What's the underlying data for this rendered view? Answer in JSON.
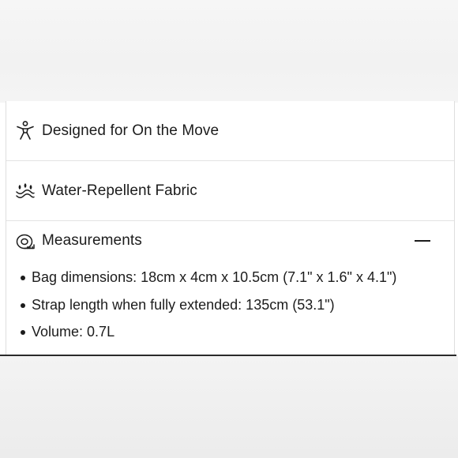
{
  "accordion": {
    "items": [
      {
        "label": "Designed for On the Move",
        "icon": "person-move-icon"
      },
      {
        "label": "Water-Repellent Fabric",
        "icon": "water-drop-icon"
      },
      {
        "label": "Measurements",
        "icon": "tape-measure-icon",
        "expanded": true,
        "toggle_icon": "minus-icon"
      }
    ],
    "measurements": [
      "Bag dimensions: 18cm x 4cm x 10.5cm (7.1\" x 1.6\" x 4.1\")",
      "Strap length when fully extended: 135cm (53.1\")",
      "Volume: 0.7L"
    ]
  }
}
